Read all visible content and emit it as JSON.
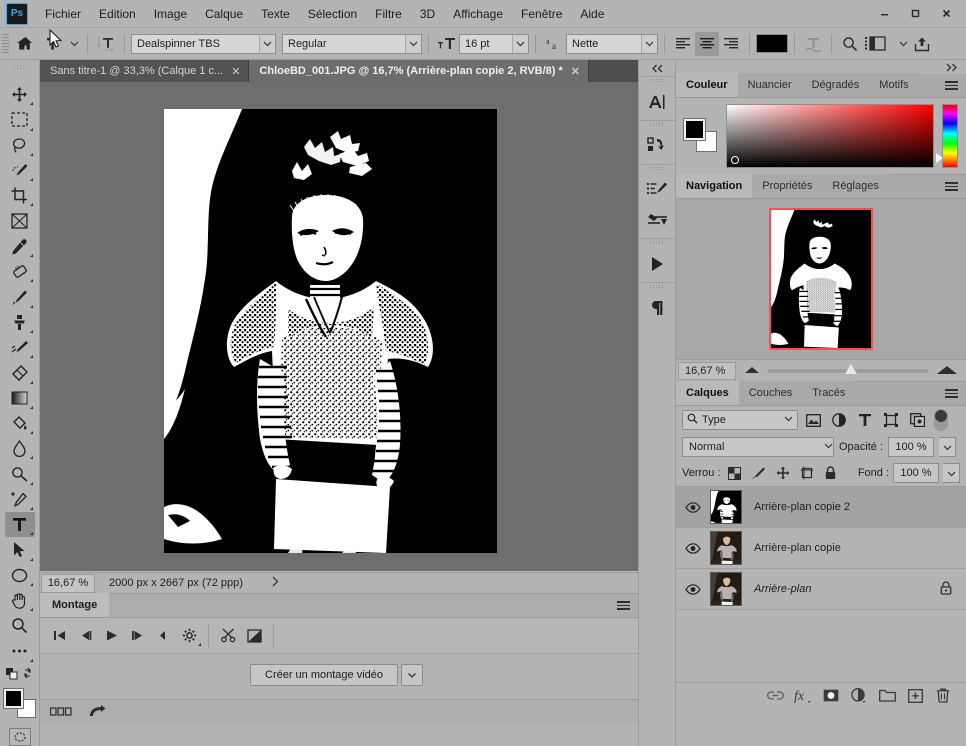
{
  "app": {
    "title": "Adobe Photoshop",
    "logo_text": "Ps"
  },
  "menubar": {
    "items": [
      "Fichier",
      "Edition",
      "Image",
      "Calque",
      "Texte",
      "Sélection",
      "Filtre",
      "3D",
      "Affichage",
      "Fenêtre",
      "Aide"
    ]
  },
  "window_controls": {
    "minimize": "–",
    "maximize": "▭",
    "close": "✕"
  },
  "options_bar": {
    "home_icon": "home-icon",
    "tool_icon": "type-tool-icon",
    "orientation_icon": "text-orientation-icon",
    "font_family": "Dealspinner TBS",
    "font_style": "Regular",
    "size_icon": "font-size-icon",
    "font_size": "16 pt",
    "antialias_icon": "anti-alias-icon",
    "antialias": "Nette",
    "align": [
      "align-left",
      "align-center",
      "align-right"
    ],
    "align_active": "align-center",
    "color_swatch": "#000000",
    "warp_icon": "warp-text-icon",
    "search_icon": "search-icon",
    "panels_icon": "toggle-panels-icon",
    "share_icon": "share-icon"
  },
  "tabs": [
    {
      "label": "Sans titre-1 @ 33,3% (Calque 1 c...",
      "close": "✕",
      "active": false
    },
    {
      "label": "ChloeBD_001.JPG @ 16,7% (Arrière-plan copie 2, RVB/8) *",
      "close": "✕",
      "active": true
    }
  ],
  "toolbar": {
    "tools": [
      {
        "name": "move-tool",
        "glyph": "✥",
        "active": false
      },
      {
        "name": "rectangular-marquee-tool",
        "glyph": "▭",
        "active": false
      },
      {
        "name": "lasso-tool",
        "glyph": "◯",
        "active": false
      },
      {
        "name": "quick-selection-tool",
        "glyph": "✎",
        "active": false
      },
      {
        "name": "crop-tool",
        "glyph": "⌗",
        "active": false
      },
      {
        "name": "frame-tool",
        "glyph": "⊠",
        "active": false
      },
      {
        "name": "eyedropper-tool",
        "glyph": "⚲",
        "active": false
      },
      {
        "name": "healing-brush-tool",
        "glyph": "⌫",
        "active": false
      },
      {
        "name": "brush-tool",
        "glyph": "✏",
        "active": false
      },
      {
        "name": "clone-stamp-tool",
        "glyph": "⌶",
        "active": false
      },
      {
        "name": "history-brush-tool",
        "glyph": "✎",
        "active": false
      },
      {
        "name": "eraser-tool",
        "glyph": "⌧",
        "active": false
      },
      {
        "name": "gradient-tool",
        "glyph": "▰",
        "active": false
      },
      {
        "name": "paint-bucket-tool",
        "glyph": "⬗",
        "active": false
      },
      {
        "name": "blur-tool",
        "glyph": "💧",
        "active": false
      },
      {
        "name": "dodge-tool",
        "glyph": "◉",
        "active": false
      },
      {
        "name": "pen-tool",
        "glyph": "✒",
        "active": false
      },
      {
        "name": "type-tool",
        "glyph": "T",
        "active": true
      },
      {
        "name": "path-selection-tool",
        "glyph": "➤",
        "active": false
      },
      {
        "name": "ellipse-shape-tool",
        "glyph": "⬭",
        "active": false
      },
      {
        "name": "hand-tool",
        "glyph": "✋",
        "active": false
      },
      {
        "name": "zoom-tool",
        "glyph": "🔍",
        "active": false
      },
      {
        "name": "edit-toolbar-more",
        "glyph": "•••",
        "active": false
      }
    ],
    "foreground_color": "#000000",
    "background_color": "#ffffff",
    "quickmask_icon": "quick-mask-icon"
  },
  "canvas": {
    "document_name": "ChloeBD_001.JPG",
    "background": "#6e6e6e",
    "image_description": "high-contrast black and white threshold portrait of a child holding a white sign"
  },
  "status_bar": {
    "zoom": "16,67 %",
    "dimensions": "2000 px x 2667 px (72 ppp)",
    "expand_icon": "chevron-right-icon"
  },
  "timeline": {
    "tab_label": "Montage",
    "menu_icon": "panel-menu-icon",
    "controls": [
      {
        "name": "go-to-first-frame-button",
        "glyph": "|◀"
      },
      {
        "name": "previous-frame-button",
        "glyph": "◀|"
      },
      {
        "name": "play-button",
        "glyph": "▶"
      },
      {
        "name": "next-frame-button",
        "glyph": "|▶"
      },
      {
        "name": "audio-button",
        "glyph": "◀"
      },
      {
        "name": "settings-button",
        "glyph": "⚙"
      },
      {
        "name": "split-clip-button",
        "glyph": "✂"
      },
      {
        "name": "transition-button",
        "glyph": "◪"
      }
    ],
    "create_button": "Créer un montage vidéo",
    "create_dropdown": "⌄",
    "footer_icons": [
      {
        "name": "frames-view-icon",
        "glyph": "▫▫▫"
      },
      {
        "name": "convert-to-frames-icon",
        "glyph": "➦"
      }
    ]
  },
  "mini_strip": {
    "collapse_icon": "double-chevron-left-icon",
    "icons": [
      {
        "name": "character-panel-icon",
        "glyph": "A|"
      },
      {
        "name": "history-panel-icon",
        "glyph": "⎘"
      },
      {
        "name": "brush-presets-panel-icon",
        "glyph": "🖌"
      },
      {
        "name": "brush-settings-panel-icon",
        "glyph": "⇔"
      },
      {
        "name": "actions-panel-icon",
        "glyph": "▶"
      },
      {
        "name": "paragraph-panel-icon",
        "glyph": "¶"
      }
    ]
  },
  "color_panel": {
    "collapse_icon": "double-chevron-right-icon",
    "tabs": [
      {
        "label": "Couleur",
        "active": true
      },
      {
        "label": "Nuancier",
        "active": false
      },
      {
        "label": "Dégradés",
        "active": false
      },
      {
        "label": "Motifs",
        "active": false
      }
    ],
    "menu_icon": "panel-menu-icon",
    "foreground": "#000000",
    "background": "#ffffff"
  },
  "navigator_panel": {
    "tabs": [
      {
        "label": "Navigation",
        "active": true
      },
      {
        "label": "Propriétés",
        "active": false
      },
      {
        "label": "Réglages",
        "active": false
      }
    ],
    "menu_icon": "panel-menu-icon",
    "zoom": "16,67 %",
    "view_border_color": "#ff4d4d",
    "zoom_out_icon": "zoom-out-icon",
    "zoom_in_icon": "zoom-in-icon"
  },
  "layers_panel": {
    "tabs": [
      {
        "label": "Calques",
        "active": true
      },
      {
        "label": "Couches",
        "active": false
      },
      {
        "label": "Tracés",
        "active": false
      }
    ],
    "menu_icon": "panel-menu-icon",
    "filter_label": "Type",
    "filter_icons": [
      {
        "name": "filter-pixel-layers-icon",
        "glyph": "▤"
      },
      {
        "name": "filter-adjustment-layers-icon",
        "glyph": "◑"
      },
      {
        "name": "filter-type-layers-icon",
        "glyph": "T"
      },
      {
        "name": "filter-shape-layers-icon",
        "glyph": "◻"
      },
      {
        "name": "filter-smart-objects-icon",
        "glyph": "⧉"
      }
    ],
    "filter_toggle": "filter-enable-toggle",
    "blend_mode": "Normal",
    "opacity_label": "Opacité :",
    "opacity_value": "100 %",
    "lock_label": "Verrou :",
    "lock_icons": [
      {
        "name": "lock-transparency-icon",
        "glyph": "▨"
      },
      {
        "name": "lock-image-icon",
        "glyph": "🖌"
      },
      {
        "name": "lock-position-icon",
        "glyph": "✥"
      },
      {
        "name": "lock-artboard-nesting-icon",
        "glyph": "⊞"
      },
      {
        "name": "lock-all-icon",
        "glyph": "🔒"
      }
    ],
    "fill_label": "Fond :",
    "fill_value": "100 %",
    "layers": [
      {
        "name": "Arrière-plan copie 2",
        "visible": true,
        "selected": true,
        "locked": false,
        "italic": false,
        "thumb": "bw"
      },
      {
        "name": "Arrière-plan copie",
        "visible": true,
        "selected": false,
        "locked": false,
        "italic": false,
        "thumb": "color"
      },
      {
        "name": "Arrière-plan",
        "visible": true,
        "selected": false,
        "locked": true,
        "italic": true,
        "thumb": "color"
      }
    ],
    "footer_icons": [
      {
        "name": "link-layers-icon",
        "glyph": "⛓"
      },
      {
        "name": "layer-style-fx-icon",
        "glyph": "fx"
      },
      {
        "name": "add-layer-mask-icon",
        "glyph": "◙"
      },
      {
        "name": "new-adjustment-layer-icon",
        "glyph": "◑"
      },
      {
        "name": "new-group-icon",
        "glyph": "🗀"
      },
      {
        "name": "new-layer-icon",
        "glyph": "⊞"
      },
      {
        "name": "delete-layer-icon",
        "glyph": "🗑"
      }
    ]
  }
}
